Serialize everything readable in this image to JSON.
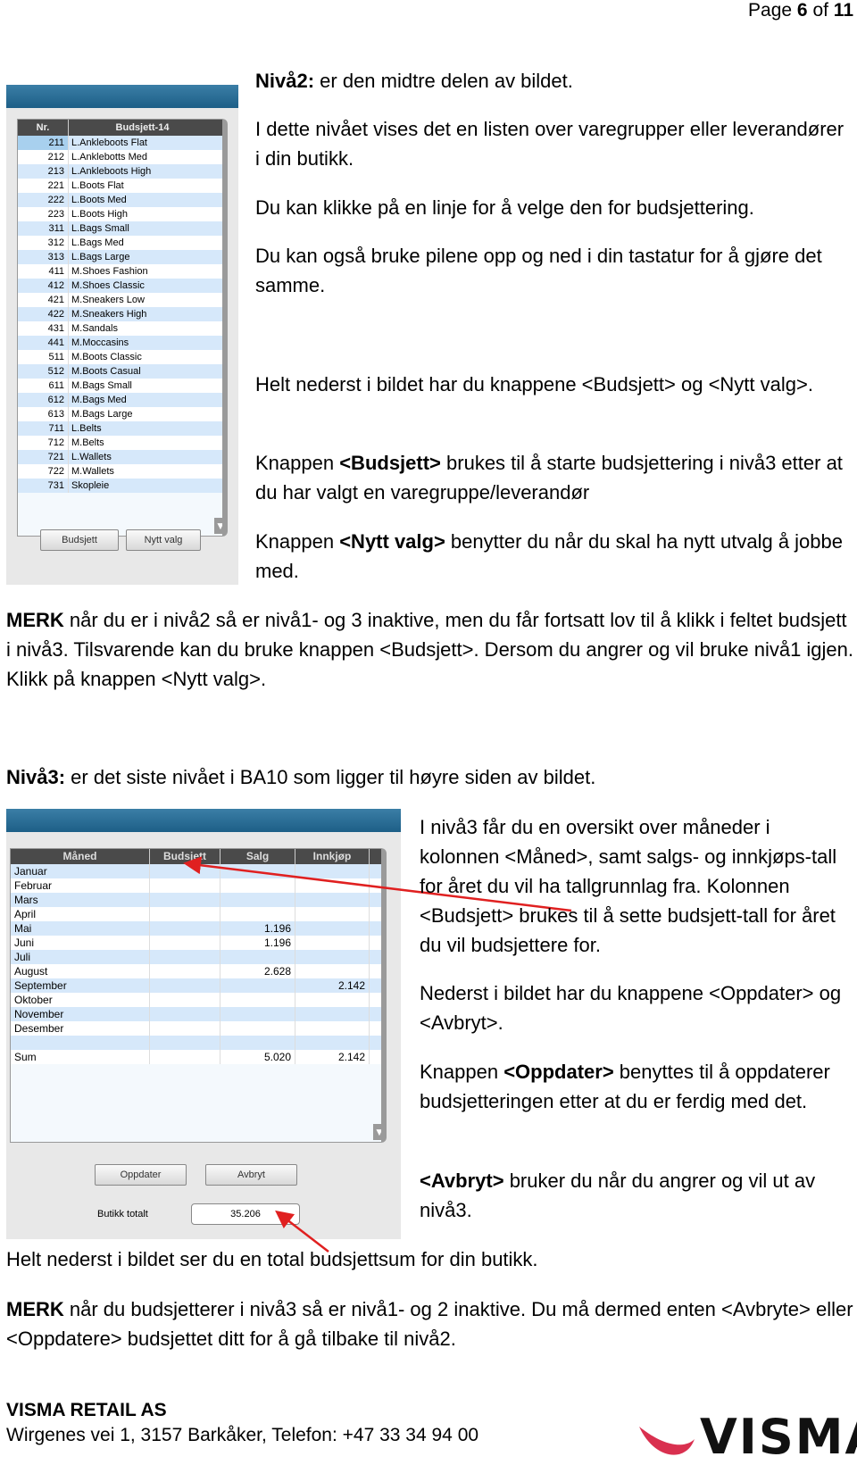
{
  "header": {
    "page_prefix": "Page",
    "page_current": "6",
    "page_of": "of",
    "page_total": "11"
  },
  "section2": {
    "title_bold": "Nivå2:",
    "title_rest": " er den midtre delen av bildet.",
    "p1": "I dette nivået vises det en listen over varegrupper eller leverandører i din butikk.",
    "p2": "Du kan klikke på en linje for å velge den for budsjettering.",
    "p3": "Du kan også bruke pilene opp og ned i din tastatur for å gjøre det samme.",
    "p4": "Helt nederst i bildet har du knappene <Budsjett> og <Nytt valg>.",
    "p5_pre": "Knappen ",
    "p5_bold": "<Budsjett>",
    "p5_post": " brukes til å starte budsjettering i nivå3 etter at du har valgt en varegruppe/leverandør",
    "p6_pre": "Knappen ",
    "p6_bold": "<Nytt valg>",
    "p6_post": " benytter du når du skal ha nytt utvalg å jobbe med.",
    "merk_bold": "MERK",
    "merk_rest": " når du er i nivå2 så er nivå1- og 3 inaktive, men du får fortsatt lov til å klikk i feltet budsjett i nivå3. Tilsvarende kan du bruke knappen <Budsjett>. Dersom du angrer og vil bruke nivå1 igjen. Klikk på knappen <Nytt valg>."
  },
  "screen1": {
    "columns": [
      "Nr.",
      "Budsjett-14"
    ],
    "rows": [
      [
        "211",
        "L.Ankleboots Flat"
      ],
      [
        "212",
        "L.Anklebotts Med"
      ],
      [
        "213",
        "L.Ankleboots High"
      ],
      [
        "221",
        "L.Boots Flat"
      ],
      [
        "222",
        "L.Boots Med"
      ],
      [
        "223",
        "L.Boots High"
      ],
      [
        "311",
        "L.Bags Small"
      ],
      [
        "312",
        "L.Bags Med"
      ],
      [
        "313",
        "L.Bags Large"
      ],
      [
        "411",
        "M.Shoes Fashion"
      ],
      [
        "412",
        "M.Shoes Classic"
      ],
      [
        "421",
        "M.Sneakers Low"
      ],
      [
        "422",
        "M.Sneakers High"
      ],
      [
        "431",
        "M.Sandals"
      ],
      [
        "441",
        "M.Moccasins"
      ],
      [
        "511",
        "M.Boots Classic"
      ],
      [
        "512",
        "M.Boots Casual"
      ],
      [
        "611",
        "M.Bags Small"
      ],
      [
        "612",
        "M.Bags Med"
      ],
      [
        "613",
        "M.Bags Large"
      ],
      [
        "711",
        "L.Belts"
      ],
      [
        "712",
        "M.Belts"
      ],
      [
        "721",
        "L.Wallets"
      ],
      [
        "722",
        "M.Wallets"
      ],
      [
        "731",
        "Skopleie"
      ]
    ],
    "budsjett_button": "Budsjett",
    "nytt_valg_button": "Nytt valg"
  },
  "section3": {
    "title_bold": "Nivå3:",
    "title_rest": " er det siste nivået i BA10 som ligger til høyre siden av bildet.",
    "p1": "I nivå3 får du en oversikt over måneder i kolonnen <Måned>, samt salgs- og innkjøps-tall for året du vil ha tallgrunnlag fra. Kolonnen <Budsjett> brukes til å sette budsjett-tall for året du vil budsjettere for.",
    "p2": "Nederst i bildet har du knappene <Oppdater> og <Avbryt>.",
    "p3_pre": "Knappen ",
    "p3_bold": "<Oppdater>",
    "p3_post": " benyttes til å oppdaterer budsjetteringen etter at du er ferdig med det.",
    "p4_bold": "<Avbryt>",
    "p4_post": " bruker du når du angrer og vil ut av nivå3.",
    "p5": "Helt nederst i bildet ser du en total budsjettsum for din butikk.",
    "merk_bold": "MERK",
    "merk_rest": " når du budsjetterer i nivå3 så er nivå1- og 2 inaktive. Du må dermed enten <Avbryte> eller <Oppdatere> budsjettet ditt for å gå tilbake til nivå2."
  },
  "screen2": {
    "columns": [
      "Måned",
      "Budsjett",
      "Salg",
      "Innkjøp"
    ],
    "rows": [
      [
        "Januar",
        "",
        "",
        ""
      ],
      [
        "Februar",
        "",
        "",
        ""
      ],
      [
        "Mars",
        "",
        "",
        ""
      ],
      [
        "April",
        "",
        "",
        ""
      ],
      [
        "Mai",
        "",
        "1.196",
        ""
      ],
      [
        "Juni",
        "",
        "1.196",
        ""
      ],
      [
        "Juli",
        "",
        "",
        ""
      ],
      [
        "August",
        "",
        "2.628",
        ""
      ],
      [
        "September",
        "",
        "",
        "2.142"
      ],
      [
        "Oktober",
        "",
        "",
        ""
      ],
      [
        "November",
        "",
        "",
        ""
      ],
      [
        "Desember",
        "",
        "",
        ""
      ],
      [
        "",
        "",
        "",
        ""
      ],
      [
        "Sum",
        "",
        "5.020",
        "2.142"
      ]
    ],
    "oppdater_button": "Oppdater",
    "avbryt_button": "Avbryt",
    "total_label": "Butikk totalt",
    "total_value": "35.206"
  },
  "footer": {
    "company": "VISMA RETAIL AS",
    "address": "Wirgenes vei 1, 3157 Barkåker, Telefon: +47 33 34 94 00",
    "logo_text": "VISMA",
    "logo_color": "#d9304f"
  }
}
